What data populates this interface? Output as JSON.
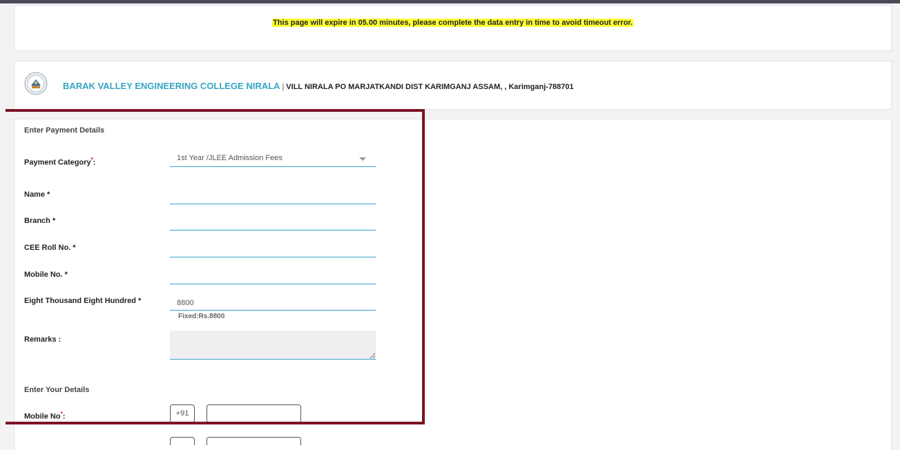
{
  "notice": {
    "text": "This page will expire in 05.00 minutes, please complete the data entry in time to avoid timeout error.",
    "highlight_color": "#ffff33"
  },
  "college": {
    "name": "BARAK VALLEY ENGINEERING COLLEGE NIRALA",
    "separator": "|",
    "address": "VILL NIRALA PO MARJATKANDI DIST KARIMGANJ ASSAM, , Karimganj-788701",
    "logo_icon": "college-emblem-icon",
    "brand_color": "#35a4c4"
  },
  "payment_section": {
    "title": "Enter Payment Details",
    "category": {
      "label": "Payment Category",
      "required_mark": "*",
      "suffix": ":",
      "value": "1st Year /JLEE Admission Fees"
    },
    "fields": {
      "name": {
        "label": "Name *",
        "value": ""
      },
      "branch": {
        "label": "Branch *",
        "value": ""
      },
      "cee_roll": {
        "label": "CEE Roll No. *",
        "value": ""
      },
      "mobile": {
        "label": "Mobile No. *",
        "value": ""
      },
      "amount": {
        "label": "Eight Thousand Eight Hundred *",
        "value": "8800",
        "hint": "Fixed:Rs.8800"
      },
      "remarks": {
        "label": "Remarks :",
        "value": ""
      }
    }
  },
  "details_section": {
    "title": "Enter Your Details",
    "mobile": {
      "label": "Mobile No",
      "required_mark": "*",
      "suffix": ":",
      "country_code": "+91",
      "value": ""
    }
  },
  "colors": {
    "frame": "#7a1324",
    "underline": "#35a4c4"
  }
}
